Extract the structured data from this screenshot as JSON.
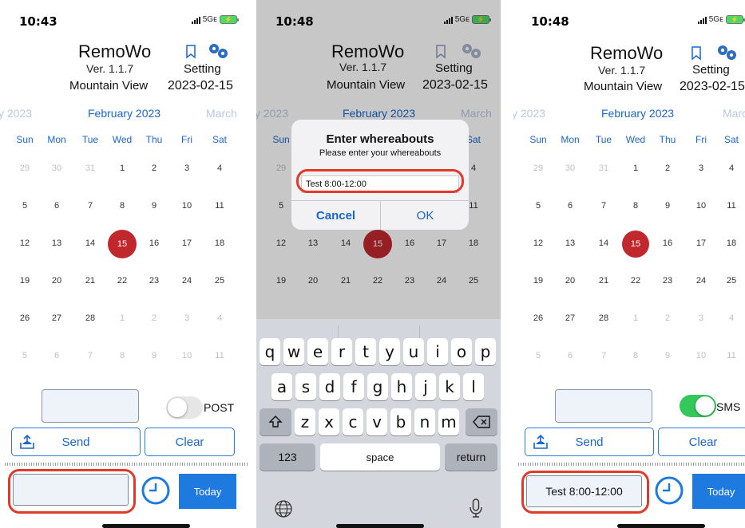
{
  "app": {
    "title": "RemoWo",
    "version": "Ver. 1.1.7",
    "location": "Mountain View",
    "setting_label": "Setting",
    "date": "2023-02-15"
  },
  "status": {
    "network": "5Gᴇ",
    "phones": [
      {
        "time": "10:43"
      },
      {
        "time": "10:48"
      },
      {
        "time": "10:48"
      }
    ]
  },
  "calendar": {
    "prev_month": "y 2023",
    "current_month": "February 2023",
    "next_month": "March",
    "next_month_short": "Marcl",
    "weekdays": [
      "Sun",
      "Mon",
      "Tue",
      "Wed",
      "Thu",
      "Fri",
      "Sat"
    ],
    "weeks": [
      [
        "29",
        "30",
        "31",
        "1",
        "2",
        "3",
        "4"
      ],
      [
        "5",
        "6",
        "7",
        "8",
        "9",
        "10",
        "11"
      ],
      [
        "12",
        "13",
        "14",
        "15",
        "16",
        "17",
        "18"
      ],
      [
        "19",
        "20",
        "21",
        "22",
        "23",
        "24",
        "25"
      ],
      [
        "26",
        "27",
        "28",
        "1",
        "2",
        "3",
        "4"
      ],
      [
        "5",
        "6",
        "7",
        "8",
        "9",
        "10",
        "11"
      ]
    ],
    "today": "15",
    "colors": {
      "accent": "#1a66cc",
      "today": "#c0282d",
      "muted": "#b9c8e2"
    }
  },
  "controls": {
    "toggle_off_label": "POST",
    "toggle_on_label": "SMS",
    "send_label": "Send",
    "clear_label": "Clear",
    "today_label": "Today",
    "result_text": "Test 8:00-12:00",
    "toggle_on_color": "#34c759",
    "today_button_color": "#1f7ae0",
    "callout_color": "#e03a2c"
  },
  "dialog": {
    "title": "Enter whereabouts",
    "message": "Please enter your whereabouts",
    "input_value": "Test 8:00-12:00",
    "cancel_label": "Cancel",
    "ok_label": "OK"
  },
  "keyboard": {
    "row1": [
      "q",
      "w",
      "e",
      "r",
      "t",
      "y",
      "u",
      "i",
      "o",
      "p"
    ],
    "row2": [
      "a",
      "s",
      "d",
      "f",
      "g",
      "h",
      "j",
      "k",
      "l"
    ],
    "row3": [
      "z",
      "x",
      "c",
      "v",
      "b",
      "n",
      "m"
    ],
    "numbers_label": "123",
    "space_label": "space",
    "return_label": "return",
    "shift_icon": "shift-icon",
    "delete_icon": "backspace-icon",
    "globe_icon": "globe-icon",
    "mic_icon": "microphone-icon"
  }
}
